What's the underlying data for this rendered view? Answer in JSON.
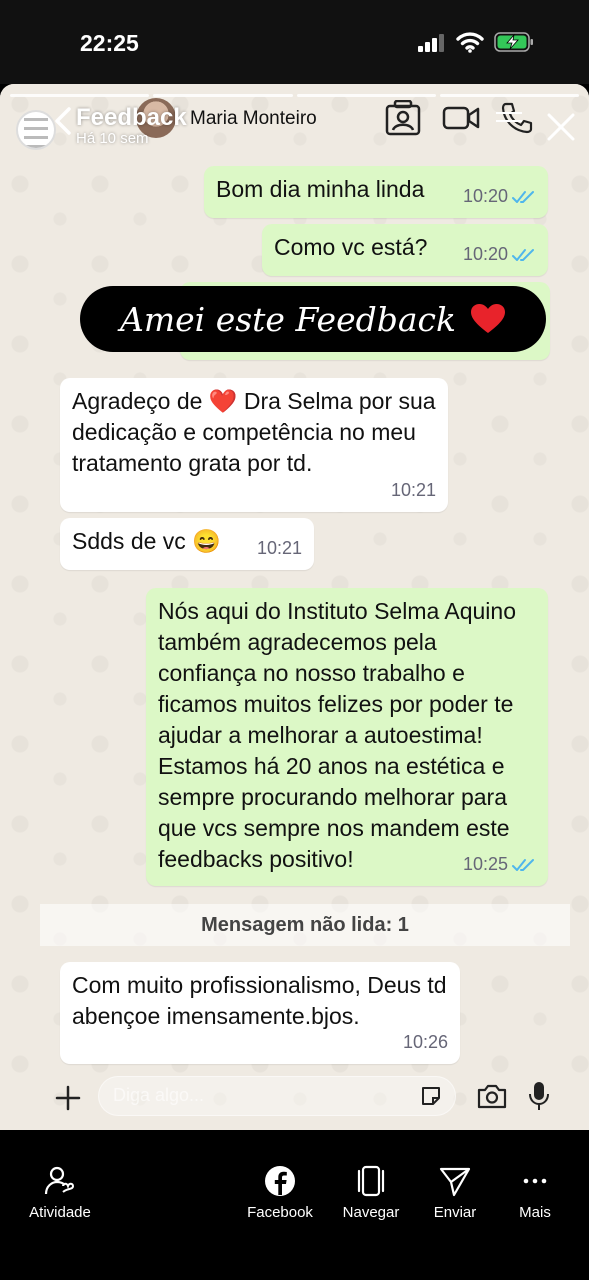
{
  "status": {
    "time": "22:25"
  },
  "story": {
    "title": "Feedback",
    "subtitle": "Há 10 sem",
    "chat_contact": "Maria Monteiro",
    "sticker_text": "Amei este Feedback"
  },
  "messages": [
    {
      "text": "Bom dia minha linda",
      "time": "10:20",
      "dir": "out"
    },
    {
      "text": "Como vc está?",
      "time": "10:20",
      "dir": "out"
    },
    {
      "text": "Agradeço de ❤️ Dra Selma por sua dedicação e competência no meu tratamento grata por td.",
      "time": "10:21",
      "dir": "in"
    },
    {
      "text": "Sdds de vc 😄",
      "time": "10:21",
      "dir": "in"
    },
    {
      "text": "Nós aqui do Instituto Selma Aquino também agradecemos pela confiança no nosso trabalho e ficamos muitos felizes por poder te ajudar a melhorar a autoestima! Estamos há 20 anos na estética e sempre procurando melhorar para que vcs sempre nos mandem este feedbacks positivo!",
      "time": "10:25",
      "dir": "out"
    },
    {
      "text": "Com muito profissionalismo, Deus td abençoe imensamente.bjos.",
      "time": "10:26",
      "dir": "in"
    }
  ],
  "unread_label": "Mensagem não lida: 1",
  "reply_placeholder": "Diga algo...",
  "nav": {
    "activity": "Atividade",
    "facebook": "Facebook",
    "navigate": "Navegar",
    "send": "Enviar",
    "more": "Mais"
  },
  "colors": {
    "outgoing": "#dcf8c6",
    "incoming": "#ffffff",
    "ticks": "#4fb6ec",
    "battery": "#34c759"
  }
}
